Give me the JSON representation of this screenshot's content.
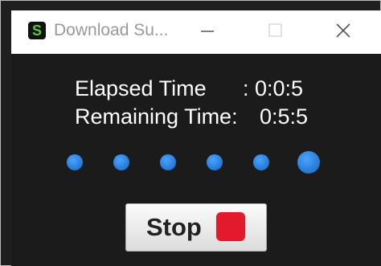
{
  "window": {
    "title": "Download Su..."
  },
  "app_icon": {
    "letter": "S",
    "color": "#5cc63f"
  },
  "timers": {
    "elapsed_label": "Elapsed Time",
    "elapsed_value": ": 0:0:5",
    "remaining_label": "Remaining Time:",
    "remaining_value": "0:5:5"
  },
  "progress": {
    "dot_count": 6,
    "active_index": 5,
    "color": "#1e88e5"
  },
  "stop_button": {
    "label": "Stop",
    "icon_color": "#e21a2c"
  }
}
